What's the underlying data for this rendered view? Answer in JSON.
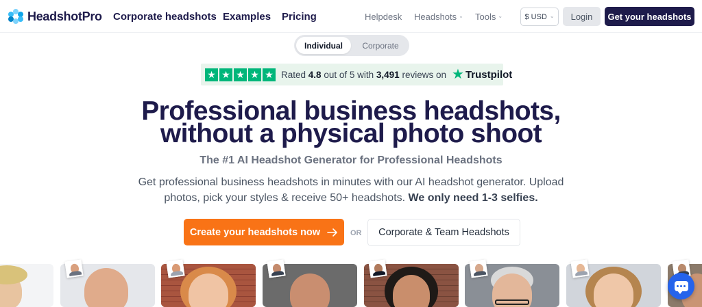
{
  "brand": {
    "name": "HeadshotPro"
  },
  "nav": {
    "primary": [
      "Corporate headshots",
      "Examples",
      "Pricing"
    ],
    "secondary": [
      {
        "label": "Helpdesk",
        "dropdown": false
      },
      {
        "label": "Headshots",
        "dropdown": true
      },
      {
        "label": "Tools",
        "dropdown": true
      }
    ],
    "currency": "$ USD",
    "login": "Login",
    "cta": "Get your headshots"
  },
  "toggle": {
    "options": [
      "Individual",
      "Corporate"
    ],
    "selected": "Individual"
  },
  "trustpilot": {
    "stars": 5,
    "prefix": "Rated",
    "rating": "4.8",
    "middle": "out of 5 with",
    "count": "3,491",
    "suffix": "reviews on",
    "brand": "Trustpilot"
  },
  "hero": {
    "title_line1": "Professional business headshots,",
    "title_line2": "without a physical photo shoot",
    "subtitle": "The #1 AI Headshot Generator for Professional Headshots",
    "desc_line1": "Get professional business headshots in minutes with our AI headshot generator. Upload",
    "desc_line2": "photos, pick your styles & receive 50+ headshots.",
    "desc_bold": "We only need 1-3 selfies."
  },
  "cta": {
    "primary": "Create your headshots now",
    "or": "OR",
    "secondary": "Corporate & Team Headshots"
  },
  "colors": {
    "brand_navy": "#1e1b4b",
    "cta_orange": "#f97316",
    "trustpilot_green": "#00b67a",
    "chat_blue": "#2563eb"
  },
  "icons": {
    "logo": "logo-mark-icon",
    "chevron": "chevron-down-icon",
    "arrow": "arrow-right-icon",
    "chat": "chat-icon"
  }
}
